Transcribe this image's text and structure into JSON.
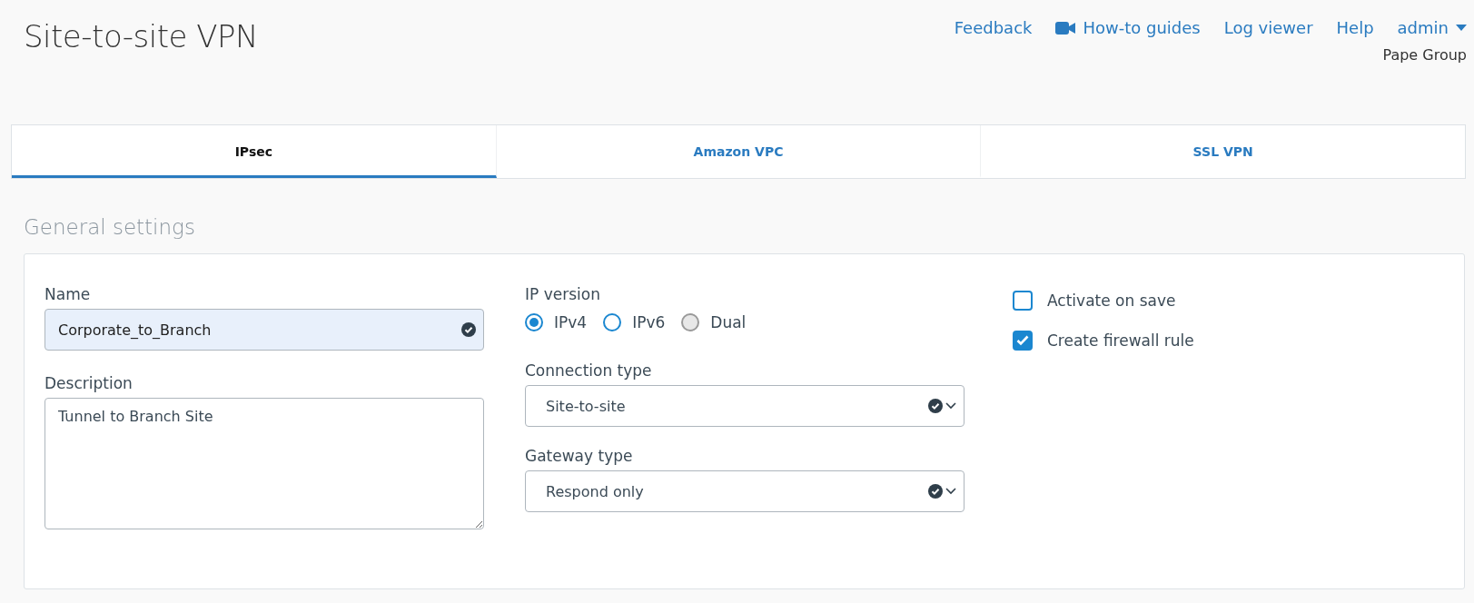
{
  "page_title": "Site-to-site VPN",
  "header_links": [
    {
      "kind": "link",
      "label": "Feedback"
    },
    {
      "kind": "video",
      "label": "How-to guides"
    },
    {
      "kind": "link",
      "label": "Log viewer"
    },
    {
      "kind": "link",
      "label": "Help"
    },
    {
      "kind": "menu",
      "label": "admin"
    }
  ],
  "organization": "Pape Group",
  "tabs": [
    {
      "label": "IPsec",
      "selected": true
    },
    {
      "label": "Amazon VPC",
      "selected": false
    },
    {
      "label": "SSL VPN",
      "selected": false
    }
  ],
  "section_title": "General settings",
  "form": {
    "name": {
      "label": "Name",
      "value": "Corporate_to_Branch",
      "valid": true
    },
    "description": {
      "label": "Description",
      "value": "Tunnel to Branch Site"
    },
    "ip_version": {
      "label": "IP version",
      "options": [
        {
          "label": "IPv4",
          "selected": true,
          "disabled": false
        },
        {
          "label": "IPv6",
          "selected": false,
          "disabled": false
        },
        {
          "label": "Dual",
          "selected": false,
          "disabled": true
        }
      ]
    },
    "connection_type": {
      "label": "Connection type",
      "value": "Site-to-site",
      "valid": true
    },
    "gateway_type": {
      "label": "Gateway type",
      "value": "Respond only",
      "valid": true
    },
    "checkboxes": [
      {
        "label": "Activate on save",
        "checked": false
      },
      {
        "label": "Create firewall rule",
        "checked": true
      }
    ]
  }
}
